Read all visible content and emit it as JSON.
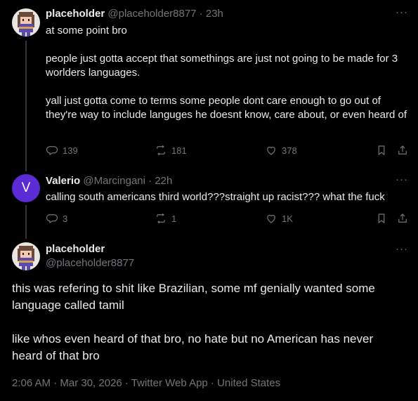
{
  "tweet1": {
    "name": "placeholder",
    "handle": "@placeholder8877",
    "time": "23h",
    "p1": "at some point bro",
    "p2": "people just gotta accept that somethings are just not going to be made for 3 worlders languages.",
    "p3": "yall just gotta come to terms some people dont care enough to go out of they're way to include languges he doesnt know, care about, or even heard of",
    "replies": "139",
    "retweets": "181",
    "likes": "378"
  },
  "tweet2": {
    "name": "Valerio",
    "handle": "@Marcingani",
    "time": "22h",
    "avatar_letter": "V",
    "text": "calling south americans third world???straight up racist??? what the fuck",
    "replies": "3",
    "retweets": "1",
    "likes": "1K"
  },
  "tweet3": {
    "name": "placeholder",
    "handle": "@placeholder8877",
    "p1": "this was refering to shit like Brazilian, some mf genially wanted some language called tamil",
    "p2": "like whos even heard of that bro, no hate but no American has never heard of that bro",
    "timestamp": "2:06 AM · Mar 30, 2026 · Twitter Web App · United States"
  },
  "icons": {
    "more": "more-icon",
    "reply": "reply-icon",
    "retweet": "retweet-icon",
    "like": "like-icon",
    "bookmark": "bookmark-icon",
    "share": "share-icon"
  },
  "colors": {
    "background": "#000000",
    "text": "#e7e9ea",
    "muted": "#71767b",
    "avatar_v": "#5b2bd6"
  }
}
